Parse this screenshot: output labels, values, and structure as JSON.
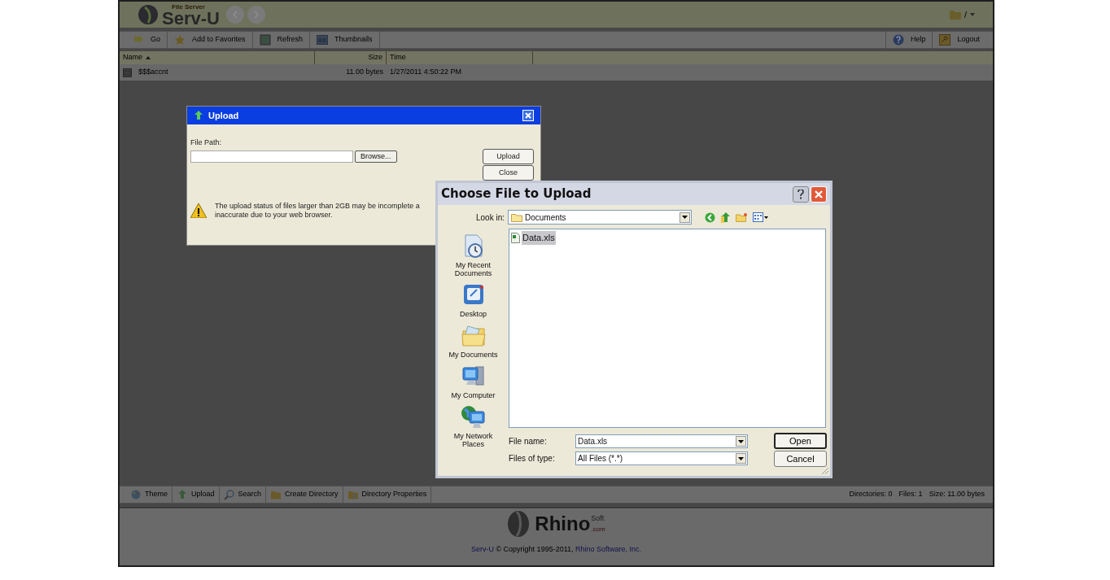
{
  "header": {
    "logo_caption": "File Server",
    "logo": "Serv-U",
    "path": "/"
  },
  "toolbar": {
    "left": [
      {
        "label": "Go"
      },
      {
        "label": "Add to Favorites"
      },
      {
        "label": "Refresh"
      },
      {
        "label": "Thumbnails"
      }
    ],
    "right": [
      {
        "label": "Help"
      },
      {
        "label": "Logout"
      }
    ]
  },
  "file_list": {
    "columns": [
      {
        "label": "Name",
        "sorted": true
      },
      {
        "label": "Size",
        "sorted": false
      },
      {
        "label": "Time",
        "sorted": false
      }
    ],
    "rows": [
      {
        "name": "$$$accnt",
        "size": "11.00 bytes",
        "time": "1/27/2011 4:50:22 PM"
      }
    ]
  },
  "bottom_toolbar": {
    "items": [
      {
        "label": "Theme"
      },
      {
        "label": "Upload"
      },
      {
        "label": "Search"
      },
      {
        "label": "Create Directory"
      },
      {
        "label": "Directory Properties"
      }
    ],
    "status": [
      "Directories: 0",
      "Files: 1",
      "Size: 11.00 bytes"
    ]
  },
  "footer": {
    "logo": "Rhino",
    "logo_super": "Soft",
    "logo_suffix": ".com",
    "copyright": [
      {
        "text": "Serv-U",
        "link": true
      },
      {
        "text": " © Copyright 1995-2011, ",
        "link": false
      },
      {
        "text": "Rhino Software, Inc.",
        "link": true
      }
    ]
  },
  "upload_dialog": {
    "title": "Upload",
    "field_label": "File Path:",
    "browse": "Browse...",
    "buttons": [
      "Upload",
      "Close"
    ],
    "warning": [
      "The upload status of files larger than 2GB may be incomplete a",
      "inaccurate due to your web browser."
    ]
  },
  "choose_dialog": {
    "title": "Choose File to Upload",
    "look_in_label": "Look in:",
    "look_in": "Documents",
    "places": [
      {
        "label": "My Recent Documents"
      },
      {
        "label": "Desktop"
      },
      {
        "label": "My Documents"
      },
      {
        "label": "My Computer"
      },
      {
        "label": "My Network Places"
      }
    ],
    "files": [
      {
        "name": "Data.xls",
        "selected": true
      }
    ],
    "file_name_label": "File name:",
    "file_name": "Data.xls",
    "type_label": "Files of type:",
    "type": "All Files (*.*)",
    "buttons": [
      "Open",
      "Cancel"
    ]
  }
}
